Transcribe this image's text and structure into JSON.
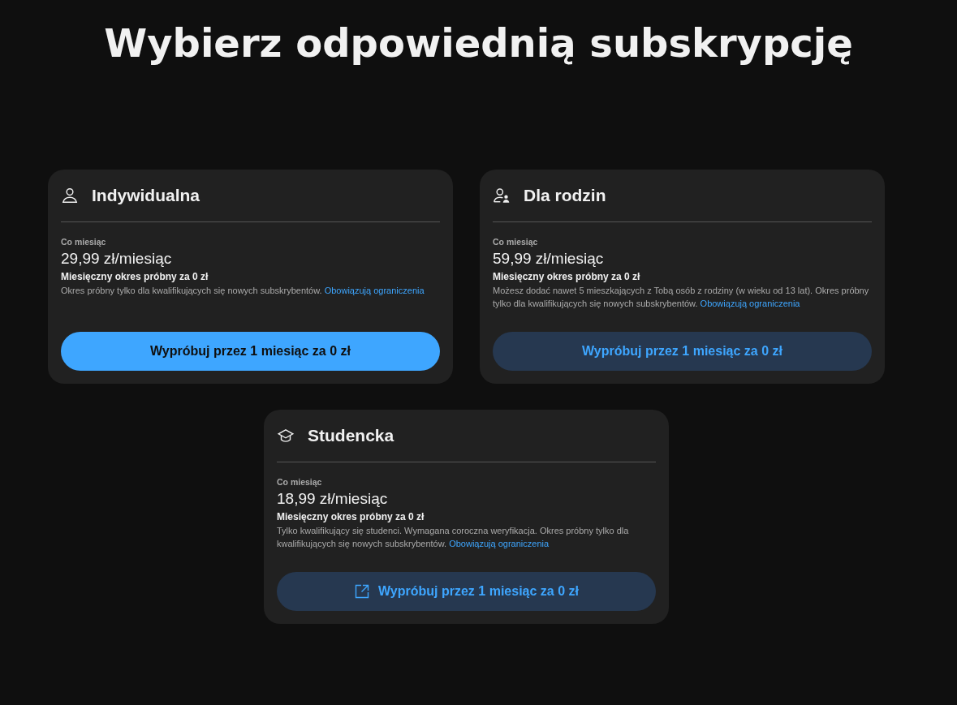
{
  "title": "Wybierz odpowiednią subskrypcję",
  "plans": [
    {
      "kind": "person",
      "name": "Indywidualna",
      "period": "Co miesiąc",
      "price": "29,99 zł/miesiąc",
      "trial": "Miesięczny okres próbny za 0 zł",
      "description": "Okres próbny tylko dla kwalifikujących się nowych subskrybentów.",
      "link": "Obowiązują ograniczenia",
      "button": {
        "label": "Wypróbuj przez 1 miesiąc za 0 zł",
        "kind": "filled",
        "external": false
      }
    },
    {
      "kind": "family",
      "name": "Dla rodzin",
      "period": "Co miesiąc",
      "price": "59,99 zł/miesiąc",
      "trial": "Miesięczny okres próbny za 0 zł",
      "description": "Możesz dodać nawet 5 mieszkających z Tobą osób z rodziny (w wieku od 13 lat). Okres próbny tylko dla kwalifikujących się nowych subskrybentów.",
      "link": "Obowiązują ograniczenia",
      "button": {
        "label": "Wypróbuj przez 1 miesiąc za 0 zł",
        "kind": "tonal",
        "external": false
      }
    },
    {
      "kind": "cap",
      "name": "Studencka",
      "period": "Co miesiąc",
      "price": "18,99 zł/miesiąc",
      "trial": "Miesięczny okres próbny za 0 zł",
      "description": "Tylko kwalifikujący się studenci. Wymagana coroczna weryfikacja. Okres próbny tylko dla kwalifikujących się nowych subskrybentów.",
      "link": "Obowiązują ograniczenia",
      "button": {
        "label": "Wypróbuj przez 1 miesiąc za 0 zł",
        "kind": "tonal",
        "external": true
      }
    }
  ]
}
